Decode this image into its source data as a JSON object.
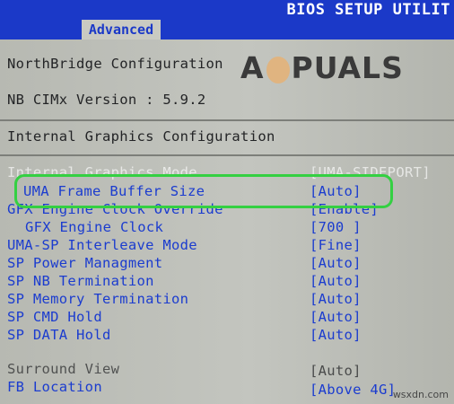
{
  "header": {
    "title": "BIOS SETUP UTILIT"
  },
  "tabs": {
    "active": "Advanced"
  },
  "sections": {
    "northbridge": "NorthBridge Configuration",
    "nb_cimx": "NB CIMx Version : 5.9.2",
    "internal_graphics": "Internal Graphics Configuration"
  },
  "settings": [
    {
      "label": "Internal Graphics Mode",
      "value": "[UMA-SIDEPORT]"
    },
    {
      "label": "UMA Frame Buffer Size",
      "value": "[Auto]"
    },
    {
      "label": "GFX Engine Clock Override",
      "value": "[Enable]"
    },
    {
      "label": "GFX Engine Clock",
      "value": "[700 ]"
    },
    {
      "label": "UMA-SP Interleave Mode",
      "value": "[Fine]"
    },
    {
      "label": "SP Power Managment",
      "value": "[Auto]"
    },
    {
      "label": "SP NB Termination",
      "value": "[Auto]"
    },
    {
      "label": "SP Memory Termination",
      "value": "[Auto]"
    },
    {
      "label": "SP CMD Hold",
      "value": "[Auto]"
    },
    {
      "label": "SP DATA Hold",
      "value": "[Auto]"
    },
    {
      "label": "Surround View",
      "value": "[Auto]"
    },
    {
      "label": "FB Location",
      "value": "[Above 4G]"
    }
  ],
  "logo": {
    "text_a": "A",
    "text_b": "PUALS"
  },
  "watermark": "wsxdn.com",
  "colors": {
    "bios_blue": "#1b39c8",
    "highlight_green": "#34d042",
    "background": "#c3c5bf"
  }
}
